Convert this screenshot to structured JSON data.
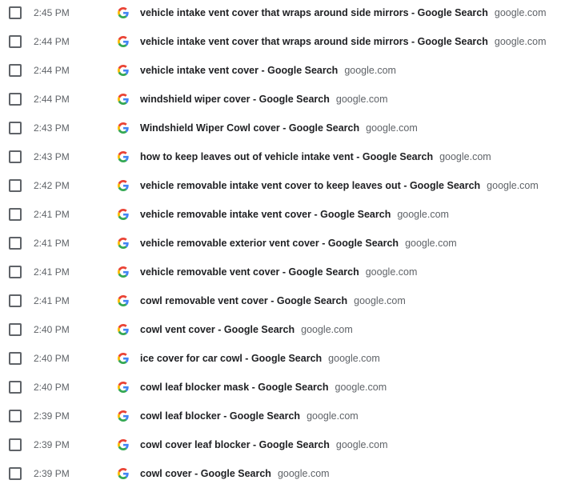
{
  "history": {
    "rows": [
      {
        "time": "2:45 PM",
        "title": "vehicle intake vent cover that wraps around side mirrors - Google Search",
        "domain": "google.com"
      },
      {
        "time": "2:44 PM",
        "title": "vehicle intake vent cover that wraps around side mirrors - Google Search",
        "domain": "google.com"
      },
      {
        "time": "2:44 PM",
        "title": "vehicle intake vent cover - Google Search",
        "domain": "google.com"
      },
      {
        "time": "2:44 PM",
        "title": "windshield wiper cover - Google Search",
        "domain": "google.com"
      },
      {
        "time": "2:43 PM",
        "title": "Windshield Wiper Cowl cover - Google Search",
        "domain": "google.com"
      },
      {
        "time": "2:43 PM",
        "title": "how to keep leaves out of vehicle intake vent - Google Search",
        "domain": "google.com"
      },
      {
        "time": "2:42 PM",
        "title": "vehicle removable intake vent cover to keep leaves out - Google Search",
        "domain": "google.com"
      },
      {
        "time": "2:41 PM",
        "title": "vehicle removable intake vent cover - Google Search",
        "domain": "google.com"
      },
      {
        "time": "2:41 PM",
        "title": "vehicle removable exterior vent cover - Google Search",
        "domain": "google.com"
      },
      {
        "time": "2:41 PM",
        "title": "vehicle removable vent cover - Google Search",
        "domain": "google.com"
      },
      {
        "time": "2:41 PM",
        "title": "cowl removable vent cover - Google Search",
        "domain": "google.com"
      },
      {
        "time": "2:40 PM",
        "title": "cowl vent cover - Google Search",
        "domain": "google.com"
      },
      {
        "time": "2:40 PM",
        "title": "ice cover for car cowl - Google Search",
        "domain": "google.com"
      },
      {
        "time": "2:40 PM",
        "title": "cowl leaf blocker mask - Google Search",
        "domain": "google.com"
      },
      {
        "time": "2:39 PM",
        "title": "cowl leaf blocker - Google Search",
        "domain": "google.com"
      },
      {
        "time": "2:39 PM",
        "title": "cowl cover leaf blocker - Google Search",
        "domain": "google.com"
      },
      {
        "time": "2:39 PM",
        "title": "cowl cover - Google Search",
        "domain": "google.com"
      }
    ],
    "favicon": "google-g-icon",
    "colors": {
      "title": "#202124",
      "secondary": "#5f6368",
      "google_blue": "#4285F4",
      "google_red": "#EA4335",
      "google_yellow": "#FBBC05",
      "google_green": "#34A853"
    }
  }
}
